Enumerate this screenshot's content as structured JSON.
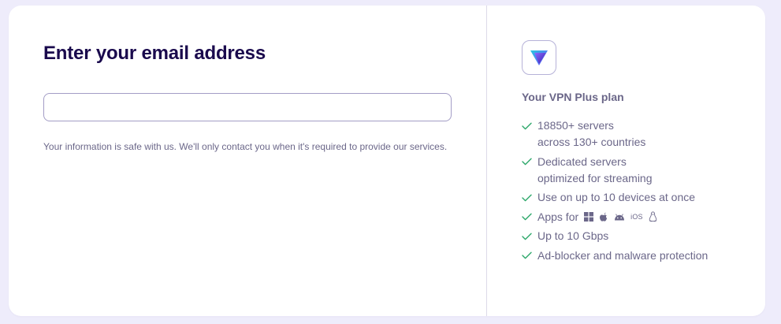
{
  "form": {
    "title": "Enter your email address",
    "email_value": "",
    "email_placeholder": "",
    "privacy_note": "Your information is safe with us. We'll only contact you when it's required to provide our services."
  },
  "plan": {
    "logo_icon": "vpn-shield-logo-icon",
    "title": "Your VPN Plus plan",
    "features": [
      {
        "lines": [
          "18850+ servers",
          "across 130+ countries"
        ]
      },
      {
        "lines": [
          "Dedicated servers",
          "optimized for streaming"
        ]
      },
      {
        "lines": [
          "Use on up to 10 devices at once"
        ]
      },
      {
        "lines": [
          "Apps for"
        ],
        "platforms": [
          "windows-icon",
          "apple-icon",
          "android-icon",
          "ios-icon",
          "linux-icon"
        ],
        "ios_label": "iOS"
      },
      {
        "lines": [
          "Up to 10 Gbps"
        ]
      },
      {
        "lines": [
          "Ad-blocker and malware protection"
        ]
      }
    ]
  },
  "colors": {
    "background": "#eeecfb",
    "title": "#1a0a4d",
    "check": "#2ea86b",
    "text_muted": "#6b6789",
    "input_border": "#a39dc6",
    "logo_gradient": [
      "#6d4aff",
      "#28c8e0"
    ]
  }
}
